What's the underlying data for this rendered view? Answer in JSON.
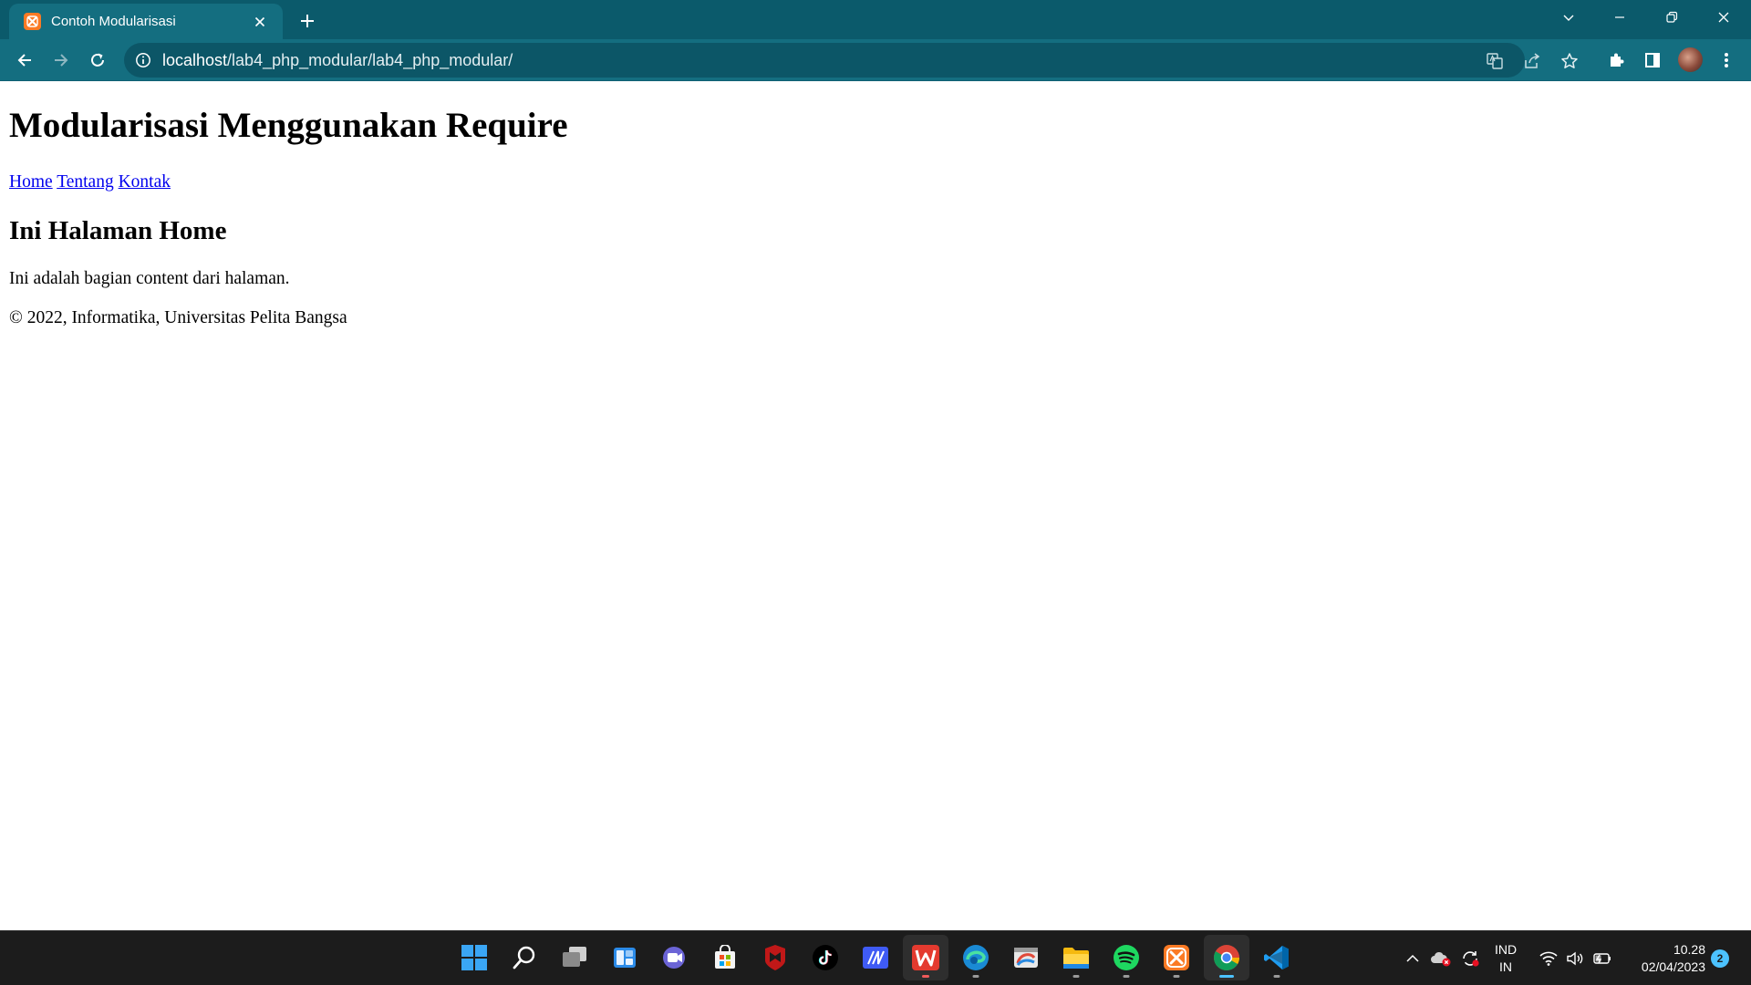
{
  "browser": {
    "tab": {
      "title": "Contoh Modularisasi",
      "favicon": "xampp-icon"
    },
    "address_bar": {
      "host": "localhost",
      "path": "/lab4_php_modular/lab4_php_modular/"
    },
    "colors": {
      "frame": "#0b5a6b",
      "toolbar": "#146e80",
      "omnibox": "#0c5667"
    }
  },
  "page": {
    "heading": "Modularisasi Menggunakan Require",
    "nav": [
      {
        "label": "Home"
      },
      {
        "label": "Tentang"
      },
      {
        "label": "Kontak"
      }
    ],
    "subheading": "Ini Halaman Home",
    "content": "Ini adalah bagian content dari halaman.",
    "footer": "© 2022, Informatika, Universitas Pelita Bangsa",
    "link_color": "#0000ee"
  },
  "taskbar": {
    "apps": [
      "windows-start-icon",
      "search-icon",
      "task-view-icon",
      "widgets-icon",
      "teams-chat-icon",
      "microsoft-store-icon",
      "mcafee-icon",
      "tiktok-icon",
      "app-icon",
      "wps-office-icon",
      "edge-icon",
      "paint-icon",
      "file-explorer-icon",
      "spotify-icon",
      "xampp-icon",
      "chrome-icon",
      "vscode-icon"
    ],
    "language": {
      "line1": "IND",
      "line2": "IN"
    },
    "clock": {
      "time": "10.28",
      "date": "02/04/2023"
    },
    "notifications": "2"
  }
}
